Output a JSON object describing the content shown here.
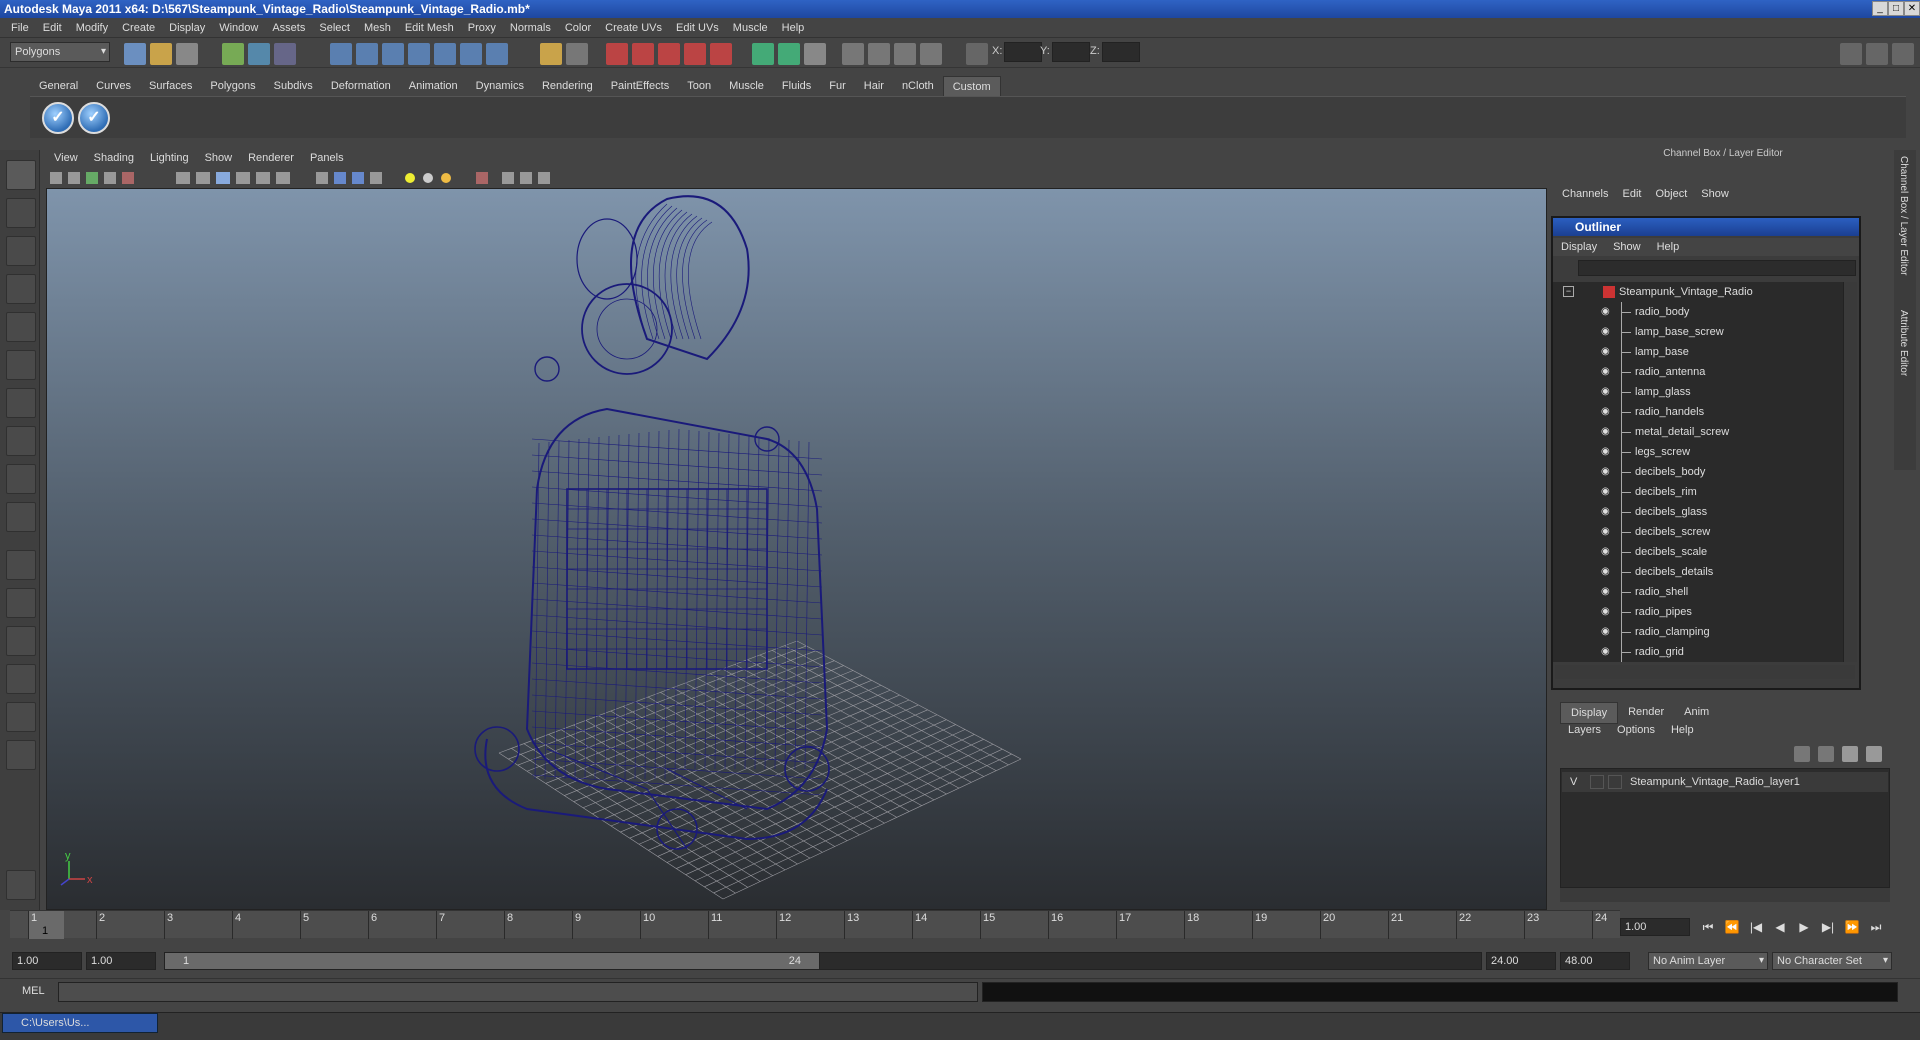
{
  "window": {
    "title": "Autodesk Maya 2011 x64: D:\\567\\Steampunk_Vintage_Radio\\Steampunk_Vintage_Radio.mb*",
    "minimize": "_",
    "maximize": "□",
    "close": "✕"
  },
  "menubar": [
    "File",
    "Edit",
    "Modify",
    "Create",
    "Display",
    "Window",
    "Assets",
    "Select",
    "Mesh",
    "Edit Mesh",
    "Proxy",
    "Normals",
    "Color",
    "Create UVs",
    "Edit UVs",
    "Muscle",
    "Help"
  ],
  "statusline": {
    "menu_set": "Polygons",
    "coord_labels": [
      "X:",
      "Y:",
      "Z:"
    ]
  },
  "shelf": {
    "tabs": [
      "General",
      "Curves",
      "Surfaces",
      "Polygons",
      "Subdivs",
      "Deformation",
      "Animation",
      "Dynamics",
      "Rendering",
      "PaintEffects",
      "Toon",
      "Muscle",
      "Fluids",
      "Fur",
      "Hair",
      "nCloth",
      "Custom"
    ],
    "active_tab": "Custom",
    "button_glyph": "✓"
  },
  "viewport": {
    "menu": [
      "View",
      "Shading",
      "Lighting",
      "Show",
      "Renderer",
      "Panels"
    ],
    "axis_y": "y",
    "axis_x": "x",
    "wire_color": "#1a1a7a",
    "grid_color": "#9a9aa0"
  },
  "channel_box": {
    "header": "Channel Box / Layer Editor",
    "menu": [
      "Channels",
      "Edit",
      "Object",
      "Show"
    ]
  },
  "outliner": {
    "title": "Outliner",
    "menu": [
      "Display",
      "Show",
      "Help"
    ],
    "root": "Steampunk_Vintage_Radio",
    "items": [
      "radio_body",
      "lamp_base_screw",
      "lamp_base",
      "radio_antenna",
      "lamp_glass",
      "radio_handels",
      "metal_detail_screw",
      "legs_screw",
      "decibels_body",
      "decibels_rim",
      "decibels_glass",
      "decibels_screw",
      "decibels_scale",
      "decibels_details",
      "radio_shell",
      "radio_pipes",
      "radio_clamping",
      "radio_grid"
    ]
  },
  "layer_editor": {
    "tabs": [
      "Display",
      "Render",
      "Anim"
    ],
    "active_tab": "Display",
    "menu": [
      "Layers",
      "Options",
      "Help"
    ],
    "layer_visibility": "V",
    "layer_name": "Steampunk_Vintage_Radio_layer1"
  },
  "side_tabs": [
    "Channel Box / Layer Editor",
    "Attribute Editor"
  ],
  "timeline": {
    "ticks": [
      "1",
      "2",
      "3",
      "4",
      "5",
      "6",
      "7",
      "8",
      "9",
      "10",
      "11",
      "12",
      "13",
      "14",
      "15",
      "16",
      "17",
      "18",
      "19",
      "20",
      "21",
      "22",
      "23",
      "24"
    ],
    "current_frame": "1.00",
    "frame_marker": "1",
    "playback_buttons": [
      "⏮",
      "⏪",
      "|◀",
      "◀",
      "▶",
      "▶|",
      "⏩",
      "⏭"
    ]
  },
  "range": {
    "start": "1.00",
    "playback_start": "1.00",
    "slider_start": "1",
    "slider_end": "24",
    "playback_end": "24.00",
    "end": "48.00",
    "anim_layer": "No Anim Layer",
    "character_set": "No Character Set"
  },
  "command_line": {
    "label": "MEL"
  },
  "taskbar": {
    "item": "C:\\Users\\Us..."
  }
}
